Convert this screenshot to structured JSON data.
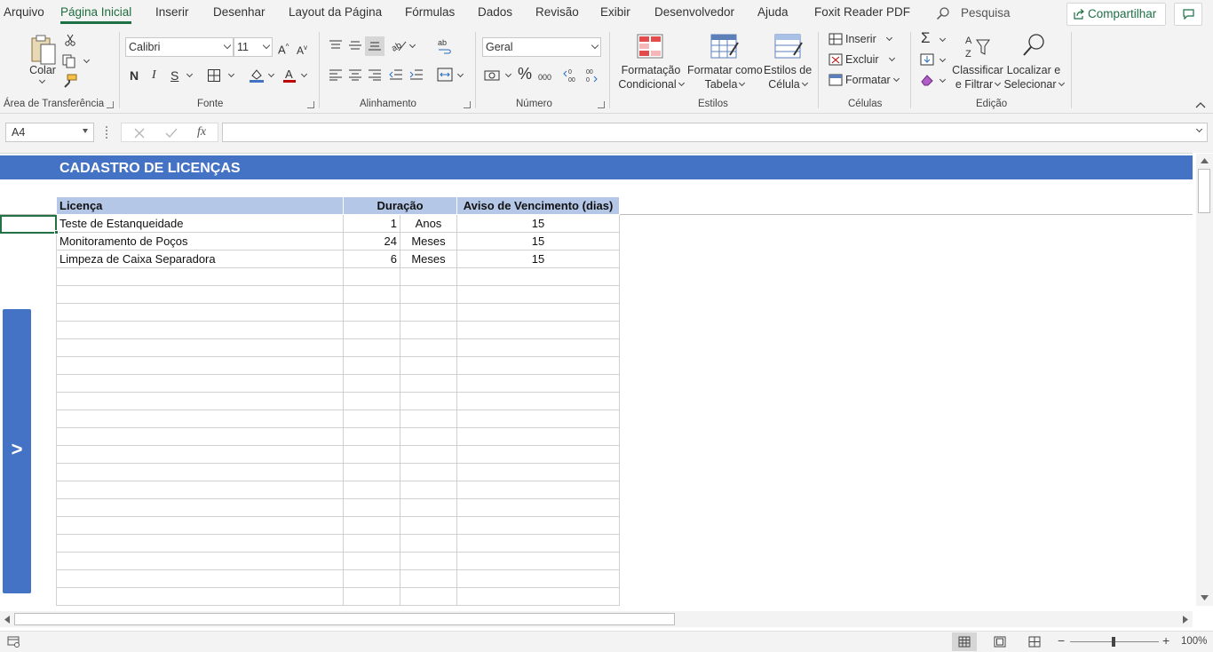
{
  "menu": {
    "tabs": [
      "Arquivo",
      "Página Inicial",
      "Inserir",
      "Desenhar",
      "Layout da Página",
      "Fórmulas",
      "Dados",
      "Revisão",
      "Exibir",
      "Desenvolvedor",
      "Ajuda",
      "Foxit Reader PDF"
    ],
    "active_tab": "Página Inicial",
    "search_label": "Pesquisa",
    "share_label": "Compartilhar"
  },
  "ribbon": {
    "clipboard": {
      "paste_label": "Colar",
      "group_label": "Área de Transferência"
    },
    "font": {
      "font_name": "Calibri",
      "font_size": "11",
      "bold_label": "N",
      "italic_label": "I",
      "underline_label": "S",
      "group_label": "Fonte"
    },
    "alignment": {
      "group_label": "Alinhamento"
    },
    "number": {
      "format": "Geral",
      "group_label": "Número"
    },
    "styles": {
      "conditional_line1": "Formatação",
      "conditional_line2": "Condicional",
      "table_line1": "Formatar como",
      "table_line2": "Tabela",
      "cell_line1": "Estilos de",
      "cell_line2": "Célula",
      "group_label": "Estilos"
    },
    "cells": {
      "insert_label": "Inserir",
      "delete_label": "Excluir",
      "format_label": "Formatar",
      "group_label": "Células"
    },
    "editing": {
      "sort_line1": "Classificar",
      "sort_line2": "e Filtrar",
      "find_line1": "Localizar e",
      "find_line2": "Selecionar",
      "group_label": "Edição"
    }
  },
  "formula_bar": {
    "name_box": "A4",
    "fx_label": "fx",
    "formula": ""
  },
  "sheet": {
    "title": "CADASTRO DE LICENÇAS",
    "side_button_label": ">",
    "headers": {
      "license": "Licença",
      "duration": "Duração",
      "notice": "Aviso de Vencimento (dias)"
    },
    "rows": [
      {
        "license": "Teste de Estanqueidade",
        "amount": "1",
        "unit": "Anos",
        "notice": "15"
      },
      {
        "license": "Monitoramento de Poços",
        "amount": "24",
        "unit": "Meses",
        "notice": "15"
      },
      {
        "license": "Limpeza de Caixa Separadora",
        "amount": "6",
        "unit": "Meses",
        "notice": "15"
      }
    ]
  },
  "status_bar": {
    "zoom": "100%"
  },
  "colors": {
    "accent_green": "#217346",
    "header_blue": "#4472c4",
    "table_header": "#b4c7e7"
  }
}
